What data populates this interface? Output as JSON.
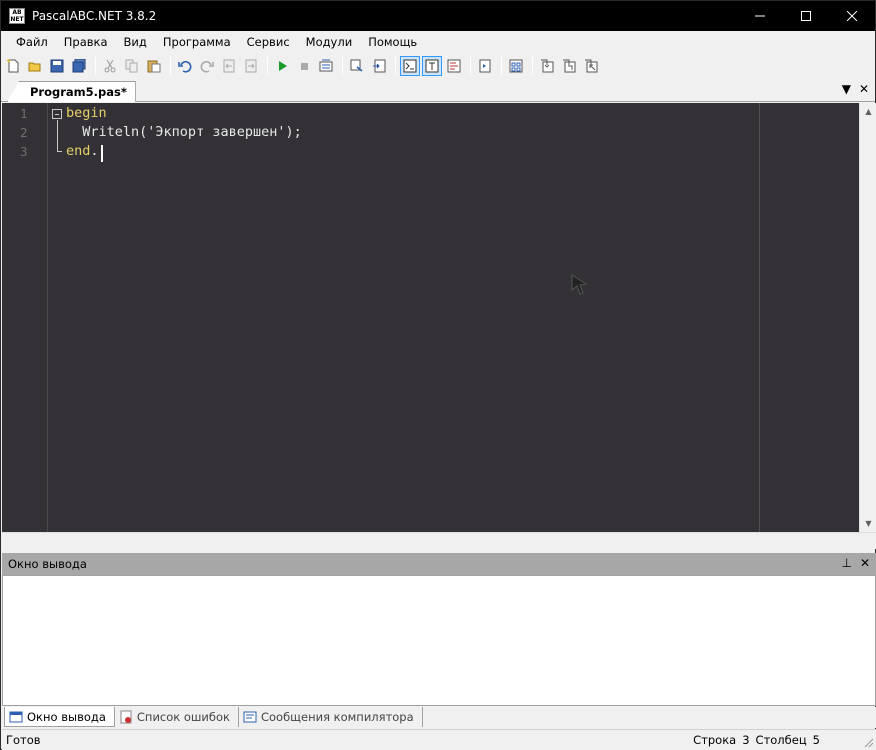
{
  "window": {
    "title": "PascalABC.NET 3.8.2",
    "icon_text": "AB NET"
  },
  "menu": [
    "Файл",
    "Правка",
    "Вид",
    "Программа",
    "Сервис",
    "Модули",
    "Помощь"
  ],
  "toolbar": {
    "icons": [
      "new-file-icon",
      "open-file-icon",
      "save-icon",
      "save-all-icon",
      "cut-icon",
      "copy-icon",
      "paste-icon",
      "undo-icon",
      "redo-icon",
      "navigate-back-icon",
      "navigate-forward-icon",
      "run-icon",
      "stop-icon",
      "compile-icon",
      "debug-icon",
      "step-icon",
      "output-window-icon",
      "form-designer-icon",
      "format-code-icon",
      "breakpoint-icon",
      "watch-icon",
      "step-into-icon",
      "step-over-icon",
      "step-out-icon"
    ],
    "active": [
      "output-window-icon",
      "form-designer-icon"
    ]
  },
  "editor": {
    "tab_label": "Program5.pas*",
    "line_numbers": [
      "1",
      "2",
      "3"
    ],
    "code": {
      "line1_kw": "begin",
      "line2_indent": "  ",
      "line2_call": "Writeln(",
      "line2_str": "'Экпорт завершен'",
      "line2_end": ");",
      "line3_kw": "end",
      "line3_end": "."
    }
  },
  "output_panel": {
    "title": "Окно вывода",
    "pin_icon": "pin-icon",
    "close_icon": "close-icon"
  },
  "bottom_tabs": [
    {
      "label": "Окно вывода",
      "icon": "output-icon",
      "active": true
    },
    {
      "label": "Список ошибок",
      "icon": "error-list-icon",
      "active": false
    },
    {
      "label": "Сообщения компилятора",
      "icon": "compiler-messages-icon",
      "active": false
    }
  ],
  "status": {
    "left": "Готов",
    "row_label": "Строка",
    "row_value": "3",
    "col_label": "Столбец",
    "col_value": "5"
  },
  "colors": {
    "editor_bg": "#333135",
    "keyword": "#e5d06a",
    "panel_header": "#a7a7a7",
    "titlebar": "#000000"
  }
}
